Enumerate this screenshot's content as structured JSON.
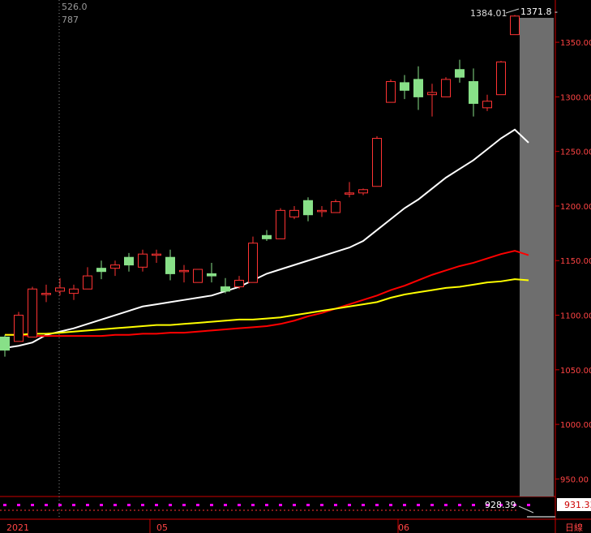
{
  "chart_data": {
    "type": "candlestick",
    "title": "",
    "ylim": [
      928,
      1385
    ],
    "y_axis_ticks": [
      950,
      1000,
      1050,
      1100,
      1150,
      1200,
      1250,
      1300,
      1350
    ],
    "y_tick_labels": [
      "950.00",
      "1000.00",
      "1050.00",
      "1100.00",
      "1150.00",
      "1200.00",
      "1250.00",
      "1300.00",
      "1350.00"
    ],
    "x_labels": [
      "2021",
      "05",
      "06"
    ],
    "x_label_at_bar": [
      0,
      11,
      29
    ],
    "time_unit_label": "日線",
    "cursor_bar": 4,
    "cursor_readouts": [
      "526.0",
      "787"
    ],
    "current_price": "1371.8",
    "current_price_tag": "1371.8 -",
    "high_label": "1384.01",
    "low_label": "928.39",
    "bottom_price_tag": "931.33",
    "up_color": "#ff3333",
    "down_color": "#88e088",
    "candles": [
      {
        "o": 1080,
        "h": 1082,
        "l": 1062,
        "c": 1068
      },
      {
        "o": 1076,
        "h": 1103,
        "l": 1076,
        "c": 1100
      },
      {
        "o": 1080,
        "h": 1126,
        "l": 1080,
        "c": 1124
      },
      {
        "o": 1120,
        "h": 1128,
        "l": 1112,
        "c": 1120
      },
      {
        "o": 1122,
        "h": 1134,
        "l": 1118,
        "c": 1125
      },
      {
        "o": 1120,
        "h": 1128,
        "l": 1114,
        "c": 1124
      },
      {
        "o": 1124,
        "h": 1144,
        "l": 1124,
        "c": 1136
      },
      {
        "o": 1143,
        "h": 1150,
        "l": 1133,
        "c": 1140
      },
      {
        "o": 1143,
        "h": 1150,
        "l": 1136,
        "c": 1146
      },
      {
        "o": 1153,
        "h": 1157,
        "l": 1140,
        "c": 1146
      },
      {
        "o": 1144,
        "h": 1160,
        "l": 1140,
        "c": 1156
      },
      {
        "o": 1156,
        "h": 1160,
        "l": 1148,
        "c": 1156
      },
      {
        "o": 1153,
        "h": 1160,
        "l": 1132,
        "c": 1138
      },
      {
        "o": 1141,
        "h": 1146,
        "l": 1130,
        "c": 1141
      },
      {
        "o": 1130,
        "h": 1142,
        "l": 1130,
        "c": 1142
      },
      {
        "o": 1138,
        "h": 1148,
        "l": 1130,
        "c": 1136
      },
      {
        "o": 1126,
        "h": 1134,
        "l": 1120,
        "c": 1122
      },
      {
        "o": 1126,
        "h": 1136,
        "l": 1124,
        "c": 1132
      },
      {
        "o": 1130,
        "h": 1172,
        "l": 1130,
        "c": 1166
      },
      {
        "o": 1173,
        "h": 1178,
        "l": 1168,
        "c": 1170
      },
      {
        "o": 1170,
        "h": 1198,
        "l": 1170,
        "c": 1196
      },
      {
        "o": 1190,
        "h": 1200,
        "l": 1188,
        "c": 1196
      },
      {
        "o": 1205,
        "h": 1208,
        "l": 1186,
        "c": 1192
      },
      {
        "o": 1196,
        "h": 1200,
        "l": 1190,
        "c": 1196
      },
      {
        "o": 1194,
        "h": 1206,
        "l": 1194,
        "c": 1204
      },
      {
        "o": 1212,
        "h": 1222,
        "l": 1208,
        "c": 1212
      },
      {
        "o": 1212,
        "h": 1216,
        "l": 1210,
        "c": 1215
      },
      {
        "o": 1218,
        "h": 1264,
        "l": 1218,
        "c": 1262
      },
      {
        "o": 1295,
        "h": 1316,
        "l": 1295,
        "c": 1314
      },
      {
        "o": 1313,
        "h": 1320,
        "l": 1298,
        "c": 1306
      },
      {
        "o": 1316,
        "h": 1328,
        "l": 1288,
        "c": 1300
      },
      {
        "o": 1302,
        "h": 1312,
        "l": 1282,
        "c": 1304
      },
      {
        "o": 1300,
        "h": 1318,
        "l": 1300,
        "c": 1316
      },
      {
        "o": 1325,
        "h": 1334,
        "l": 1313,
        "c": 1318
      },
      {
        "o": 1314,
        "h": 1326,
        "l": 1282,
        "c": 1294
      },
      {
        "o": 1290,
        "h": 1302,
        "l": 1287,
        "c": 1296
      },
      {
        "o": 1302,
        "h": 1333,
        "l": 1302,
        "c": 1332
      },
      {
        "o": 1357,
        "h": 1375,
        "l": 1357,
        "c": 1374
      },
      {
        "o": 1378,
        "h": 1384,
        "l": 1378,
        "c": 1382
      }
    ],
    "moving_averages": [
      {
        "color": "#ffffff",
        "values": [
          1070,
          1072,
          1075,
          1082,
          1085,
          1088,
          1092,
          1096,
          1100,
          1104,
          1108,
          1110,
          1112,
          1114,
          1116,
          1118,
          1122,
          1126,
          1132,
          1138,
          1142,
          1146,
          1150,
          1154,
          1158,
          1162,
          1168,
          1178,
          1188,
          1198,
          1206,
          1216,
          1226,
          1234,
          1242,
          1252,
          1262,
          1270,
          1258
        ]
      },
      {
        "color": "#ff0000",
        "values": [
          1082,
          1082,
          1081,
          1081,
          1081,
          1081,
          1081,
          1081,
          1082,
          1082,
          1083,
          1083,
          1084,
          1084,
          1085,
          1086,
          1087,
          1088,
          1089,
          1090,
          1092,
          1095,
          1099,
          1102,
          1106,
          1110,
          1114,
          1118,
          1123,
          1127,
          1132,
          1137,
          1141,
          1145,
          1148,
          1152,
          1156,
          1159,
          1155
        ]
      },
      {
        "color": "#ffff00",
        "values": [
          1082,
          1082,
          1083,
          1083,
          1084,
          1085,
          1086,
          1087,
          1088,
          1089,
          1090,
          1091,
          1091,
          1092,
          1093,
          1094,
          1095,
          1096,
          1096,
          1097,
          1098,
          1100,
          1102,
          1104,
          1106,
          1108,
          1110,
          1112,
          1116,
          1119,
          1121,
          1123,
          1125,
          1126,
          1128,
          1130,
          1131,
          1133,
          1132
        ]
      }
    ]
  }
}
